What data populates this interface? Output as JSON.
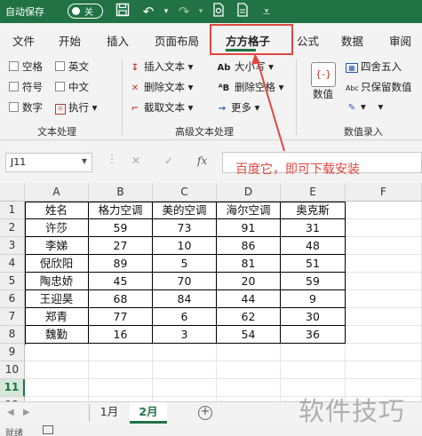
{
  "titlebar": {
    "autosave_label": "自动保存",
    "autosave_state": "关",
    "icons": [
      "save-icon",
      "undo-icon",
      "redo-icon",
      "new-doc-icon",
      "print-preview-icon"
    ]
  },
  "tabs": [
    {
      "label": "文件"
    },
    {
      "label": "开始"
    },
    {
      "label": "插入"
    },
    {
      "label": "页面布局"
    },
    {
      "label": "方方格子",
      "active": true
    },
    {
      "label": "公式"
    },
    {
      "label": "数据"
    },
    {
      "label": "审阅"
    }
  ],
  "ribbon": {
    "text_group": {
      "items": [
        "空格",
        "英文",
        "符号",
        "中文",
        "数字",
        "执行"
      ],
      "label": "文本处理"
    },
    "adv_group": {
      "insert_text": "插入文本",
      "delete_text": "删除文本",
      "extract_text": "截取文本",
      "case": "大小写",
      "delete_space": "删除空格",
      "more": "更多",
      "label": "高级文本处理"
    },
    "value_group": {
      "numeric": "数值",
      "round": "四舍五入",
      "keep_value": "只保留数值",
      "label": "数值录入"
    }
  },
  "formula_bar": {
    "name_box": "J11",
    "fx": "fx",
    "value": ""
  },
  "annotation": "百度它，即可下载安装",
  "sheet": {
    "columns": [
      "A",
      "B",
      "C",
      "D",
      "E",
      "F"
    ],
    "rows": [
      "1",
      "2",
      "3",
      "4",
      "5",
      "6",
      "7",
      "8",
      "9",
      "10",
      "11",
      "12"
    ],
    "active_row": "11",
    "data": [
      [
        "姓名",
        "格力空调",
        "美的空调",
        "海尔空调",
        "奥克斯"
      ],
      [
        "许莎",
        "59",
        "73",
        "91",
        "31"
      ],
      [
        "李娣",
        "27",
        "10",
        "86",
        "48"
      ],
      [
        "倪欣阳",
        "89",
        "5",
        "81",
        "51"
      ],
      [
        "陶忠娇",
        "45",
        "70",
        "20",
        "59"
      ],
      [
        "王迎昊",
        "68",
        "84",
        "44",
        "9"
      ],
      [
        "郑青",
        "77",
        "6",
        "62",
        "30"
      ],
      [
        "魏勤",
        "16",
        "3",
        "54",
        "36"
      ]
    ]
  },
  "sheet_tabs": [
    {
      "label": "1月"
    },
    {
      "label": "2月",
      "active": true
    }
  ],
  "status": "就绪",
  "watermark": "软件技巧"
}
